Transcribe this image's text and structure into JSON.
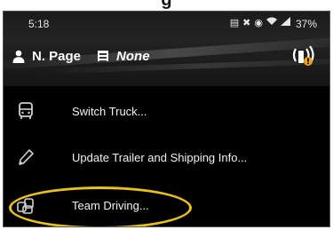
{
  "caption": "g",
  "status_bar": {
    "time": "5:18",
    "battery": "37%",
    "icons": [
      "vibrate-icon",
      "mute-icon",
      "location-icon",
      "wifi-icon",
      "signal-icon"
    ]
  },
  "header": {
    "driver_name": "N. Page",
    "trailer_value": "None"
  },
  "menu": {
    "items": [
      {
        "label": "Switch Truck...",
        "icon": "truck-icon"
      },
      {
        "label": "Update Trailer and Shipping Info...",
        "icon": "pencil-icon"
      },
      {
        "label": "Team Driving...",
        "icon": "team-icon"
      }
    ]
  },
  "colors": {
    "background": "#000000",
    "text": "#f2f2f2",
    "highlight": "#e8c21a",
    "badge": "#f0a020"
  }
}
